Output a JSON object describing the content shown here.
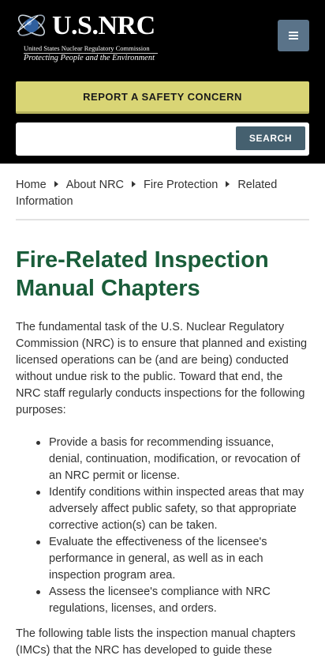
{
  "header": {
    "logo_title": "U.S.NRC",
    "logo_subtitle": "United States Nuclear Regulatory Commission",
    "logo_tagline": "Protecting People and the Environment",
    "menu_icon": "hamburger-icon"
  },
  "safety": {
    "label": "REPORT A SAFETY CONCERN"
  },
  "search": {
    "value": "",
    "placeholder": "",
    "button_label": "SEARCH"
  },
  "breadcrumb": {
    "items": [
      "Home",
      "About NRC",
      "Fire Protection",
      "Related Information"
    ]
  },
  "main": {
    "title": "Fire-Related Inspection Manual Chapters",
    "intro": "The fundamental task of the U.S. Nuclear Regulatory Commission (NRC) is to ensure that planned and existing licensed operations can be (and are being) conducted without undue risk to the public. Toward that end, the NRC staff regularly conducts inspections for the following purposes:",
    "purposes": [
      "Provide a basis for recommending issuance, denial, continuation, modification, or revocation of an NRC permit or license.",
      "Identify conditions within inspected areas that may adversely affect public safety, so that appropriate corrective action(s) can be taken.",
      "Evaluate the effectiveness of the licensee's performance in general, as well as in each inspection program area.",
      "Assess the licensee's compliance with NRC regulations, licenses, and orders."
    ],
    "outro": "The following table lists the inspection manual chapters (IMCs) that the NRC has developed to guide these"
  },
  "colors": {
    "header_bg": "#000000",
    "safety_button": "#d9d575",
    "search_button": "#45606f",
    "menu_button": "#5a7389",
    "title_green": "#1a5d3a"
  }
}
